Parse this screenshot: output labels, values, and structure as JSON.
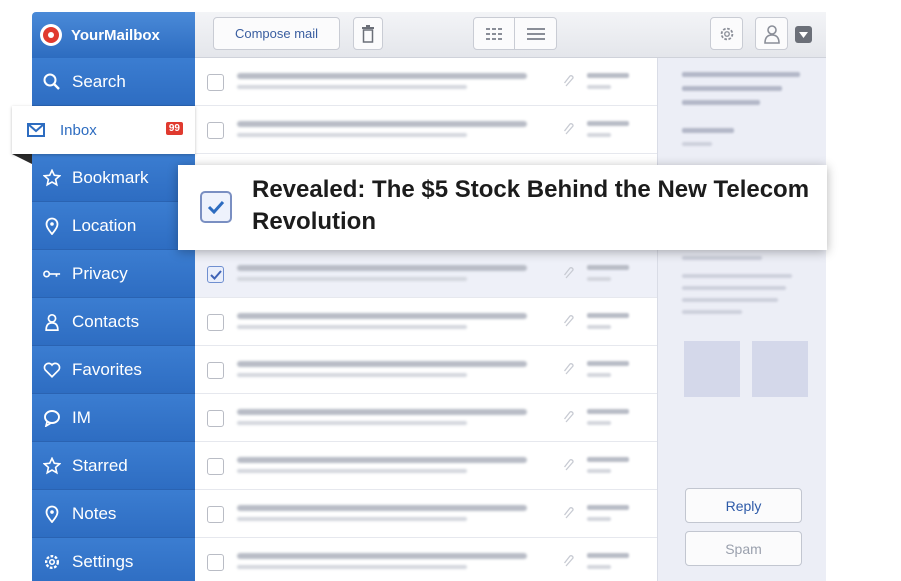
{
  "app": {
    "name": "YourMailbox"
  },
  "toolbar": {
    "compose_label": "Compose mail"
  },
  "sidebar": {
    "items": [
      {
        "label": "Search",
        "icon": "search-icon"
      },
      {
        "label": "Inbox",
        "icon": "envelope-icon",
        "badge": "99",
        "active": true
      },
      {
        "label": "Bookmark",
        "icon": "star-icon"
      },
      {
        "label": "Location",
        "icon": "location-pin-icon"
      },
      {
        "label": "Privacy",
        "icon": "key-icon"
      },
      {
        "label": "Contacts",
        "icon": "person-icon"
      },
      {
        "label": "Favorites",
        "icon": "heart-icon"
      },
      {
        "label": "IM",
        "icon": "chat-bubble-icon"
      },
      {
        "label": "Starred",
        "icon": "star-icon"
      },
      {
        "label": "Notes",
        "icon": "location-pin-icon"
      },
      {
        "label": "Settings",
        "icon": "gear-icon"
      }
    ]
  },
  "messages": {
    "selected_row": 4
  },
  "callout": {
    "text": "Revealed: The $5 Stock Behind the New Telecom Revolution"
  },
  "preview": {
    "reply_label": "Reply",
    "spam_label": "Spam"
  },
  "colors": {
    "sidebar": "#2d6cc0",
    "badge": "#e03a2f",
    "logo": "#e03a2f"
  }
}
